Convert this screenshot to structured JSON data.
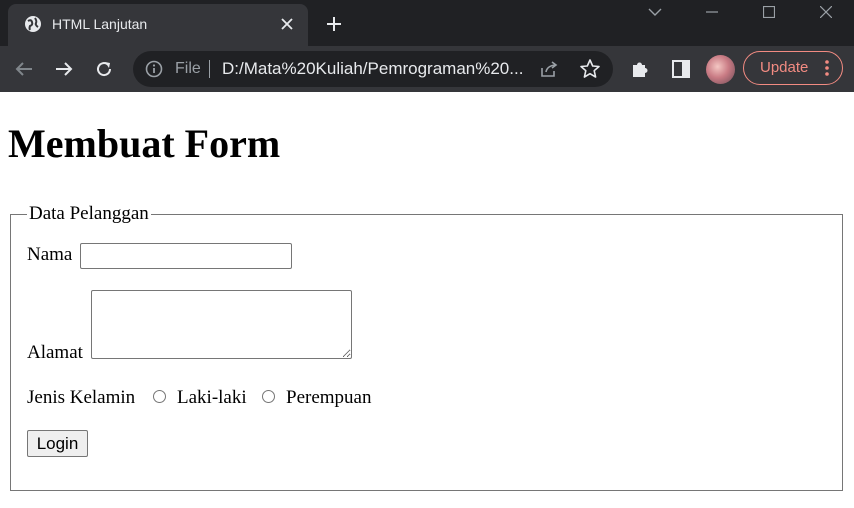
{
  "browser": {
    "tab": {
      "title": "HTML Lanjutan"
    },
    "omnibox": {
      "scheme_label": "File",
      "url": "D:/Mata%20Kuliah/Pemrograman%20..."
    },
    "update_label": "Update",
    "accent_color": "#f28b82"
  },
  "page": {
    "heading": "Membuat Form",
    "form": {
      "legend": "Data Pelanggan",
      "nama_label": "Nama",
      "nama_value": "",
      "alamat_label": "Alamat",
      "alamat_value": "",
      "gender_label": "Jenis Kelamin",
      "gender_options": [
        "Laki-laki",
        "Perempuan"
      ],
      "submit_label": "Login"
    }
  }
}
